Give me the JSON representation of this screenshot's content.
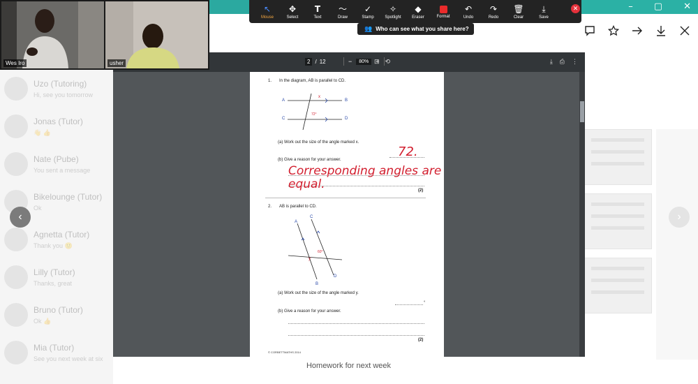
{
  "window": {
    "minimize": "–",
    "maximize": "▢",
    "close": "✕"
  },
  "browser_actions": [
    "chat-icon",
    "star-icon",
    "forward-icon",
    "download-icon",
    "close-icon"
  ],
  "meeting": {
    "participants": [
      {
        "name": "Wes Iro"
      },
      {
        "name": "usher"
      }
    ],
    "toolbar": {
      "items": [
        {
          "label": "Mouse",
          "icon": "↖"
        },
        {
          "label": "Select",
          "icon": "✥"
        },
        {
          "label": "Text",
          "icon": "T"
        },
        {
          "label": "Draw",
          "icon": "〜"
        },
        {
          "label": "Stamp",
          "icon": "✓"
        },
        {
          "label": "Spotlight",
          "icon": "✧"
        },
        {
          "label": "Eraser",
          "icon": "◆"
        },
        {
          "label": "Format",
          "icon": ""
        },
        {
          "label": "Undo",
          "icon": "↶"
        },
        {
          "label": "Redo",
          "icon": "↷"
        },
        {
          "label": "Clear",
          "icon": "🗑"
        },
        {
          "label": "Save",
          "icon": "⤓"
        }
      ],
      "active": "Mouse",
      "accent_color": "#f4a742",
      "stop_color": "#e5313b"
    },
    "share_notice": "Who can see what you share here?"
  },
  "background": {
    "chats": [
      {
        "name": "Uzo (Tutoring)",
        "preview": "Hi, see you tomorrow"
      },
      {
        "name": "Jonas (Tutor)",
        "preview": "👋 👍"
      },
      {
        "name": "Nate (Pube)",
        "preview": "You sent a message"
      },
      {
        "name": "Bikelounge (Tutor)",
        "preview": "Ok"
      },
      {
        "name": "Agnetta (Tutor)",
        "preview": "Thank you 🙂"
      },
      {
        "name": "Lilly (Tutor)",
        "preview": "Thanks, great"
      },
      {
        "name": "Bruno (Tutor)",
        "preview": "Ok 👍"
      },
      {
        "name": "Mia (Tutor)",
        "preview": "See you next week at six"
      }
    ],
    "caption": "Homework for next week",
    "nav_prev": "‹",
    "nav_next": "›"
  },
  "pdf_viewer": {
    "page_current": "2",
    "page_total": "12",
    "zoom": "80%",
    "page": {
      "q1": {
        "number": "1.",
        "text": "In the diagram, AB is parallel to CD.",
        "labels": {
          "A": "A",
          "B": "B",
          "C": "C",
          "D": "D",
          "x": "x",
          "angle": "72°"
        },
        "part_a": "(a)   Work out the size of the angle marked x.",
        "part_b": "(b)   Give a reason for your answer.",
        "marks": "(2)"
      },
      "q2": {
        "number": "2.",
        "text": "AB is parallel to CD.",
        "labels": {
          "A": "A",
          "B": "B",
          "C": "C",
          "D": "D",
          "y": "y",
          "angle": "60°"
        },
        "part_a": "(a)   Work out the size of the angle marked y.",
        "part_a_unit": "°",
        "part_b": "(b)   Give a reason for your answer.",
        "marks": "(2)"
      },
      "footer": "© CORBETTMATHS 2014"
    },
    "annotations": {
      "answer_x": "72.",
      "reason_line1": "Corresponding angles are",
      "reason_line2": "equal.",
      "ink_color": "#d21f2f"
    }
  }
}
